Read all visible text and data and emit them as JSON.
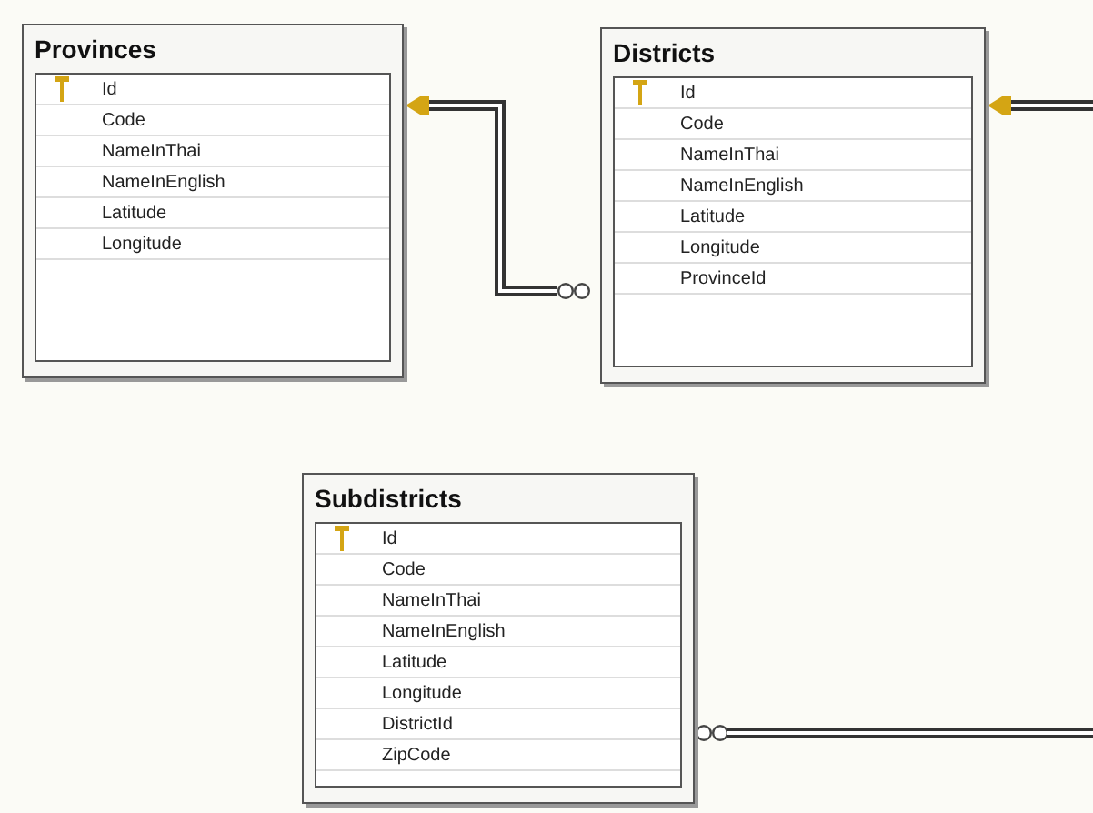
{
  "tables": [
    {
      "name": "Provinces",
      "columns": [
        {
          "name": "Id",
          "primary_key": true
        },
        {
          "name": "Code",
          "primary_key": false
        },
        {
          "name": "NameInThai",
          "primary_key": false
        },
        {
          "name": "NameInEnglish",
          "primary_key": false
        },
        {
          "name": "Latitude",
          "primary_key": false
        },
        {
          "name": "Longitude",
          "primary_key": false
        }
      ]
    },
    {
      "name": "Districts",
      "columns": [
        {
          "name": "Id",
          "primary_key": true
        },
        {
          "name": "Code",
          "primary_key": false
        },
        {
          "name": "NameInThai",
          "primary_key": false
        },
        {
          "name": "NameInEnglish",
          "primary_key": false
        },
        {
          "name": "Latitude",
          "primary_key": false
        },
        {
          "name": "Longitude",
          "primary_key": false
        },
        {
          "name": "ProvinceId",
          "primary_key": false
        }
      ]
    },
    {
      "name": "Subdistricts",
      "columns": [
        {
          "name": "Id",
          "primary_key": true
        },
        {
          "name": "Code",
          "primary_key": false
        },
        {
          "name": "NameInThai",
          "primary_key": false
        },
        {
          "name": "NameInEnglish",
          "primary_key": false
        },
        {
          "name": "Latitude",
          "primary_key": false
        },
        {
          "name": "Longitude",
          "primary_key": false
        },
        {
          "name": "DistrictId",
          "primary_key": false
        },
        {
          "name": "ZipCode",
          "primary_key": false
        }
      ]
    }
  ]
}
